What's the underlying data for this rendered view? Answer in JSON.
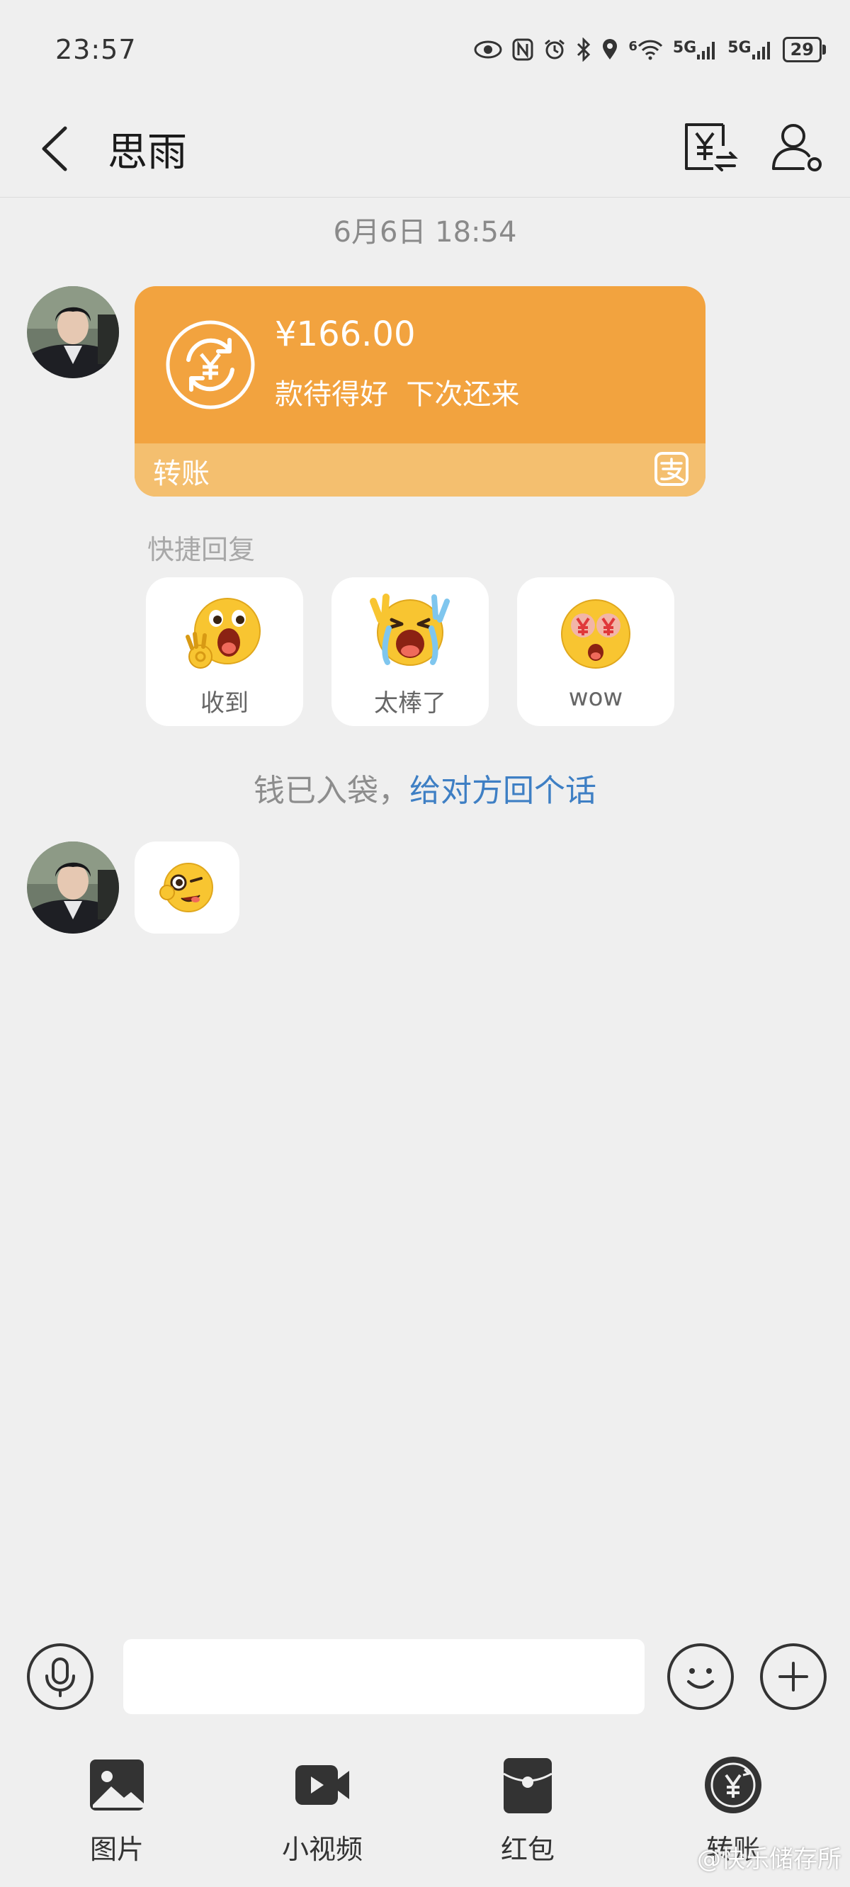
{
  "status_bar": {
    "time": "23:57",
    "signal1": "5G",
    "signal2": "5G",
    "wifi_tag": "6",
    "battery": "29"
  },
  "header": {
    "title": "思雨"
  },
  "chat": {
    "timestamp": "6月6日 18:54",
    "transfer": {
      "amount": "¥166.00",
      "note": "款待得好  下次还来",
      "label": "转账"
    },
    "quick_reply": {
      "title": "快捷回复",
      "options": [
        {
          "label": "收到",
          "emoji": "ok-hand-emoji"
        },
        {
          "label": "太棒了",
          "emoji": "crying-cheer-emoji"
        },
        {
          "label": "wow",
          "emoji": "money-eyes-emoji"
        }
      ]
    },
    "notice": {
      "text": "钱已入袋，",
      "link": "给对方回个话"
    }
  },
  "toolbar": {
    "items": [
      {
        "label": "图片",
        "icon": "image-icon"
      },
      {
        "label": "小视频",
        "icon": "video-icon"
      },
      {
        "label": "红包",
        "icon": "red-packet-icon"
      },
      {
        "label": "转账",
        "icon": "transfer-icon"
      }
    ]
  },
  "watermark": "@快乐储存所",
  "colors": {
    "transfer_card": "#f2a33f",
    "transfer_card_footer": "#f4bf6f",
    "link": "#3e7fc4",
    "background": "#efefef"
  }
}
